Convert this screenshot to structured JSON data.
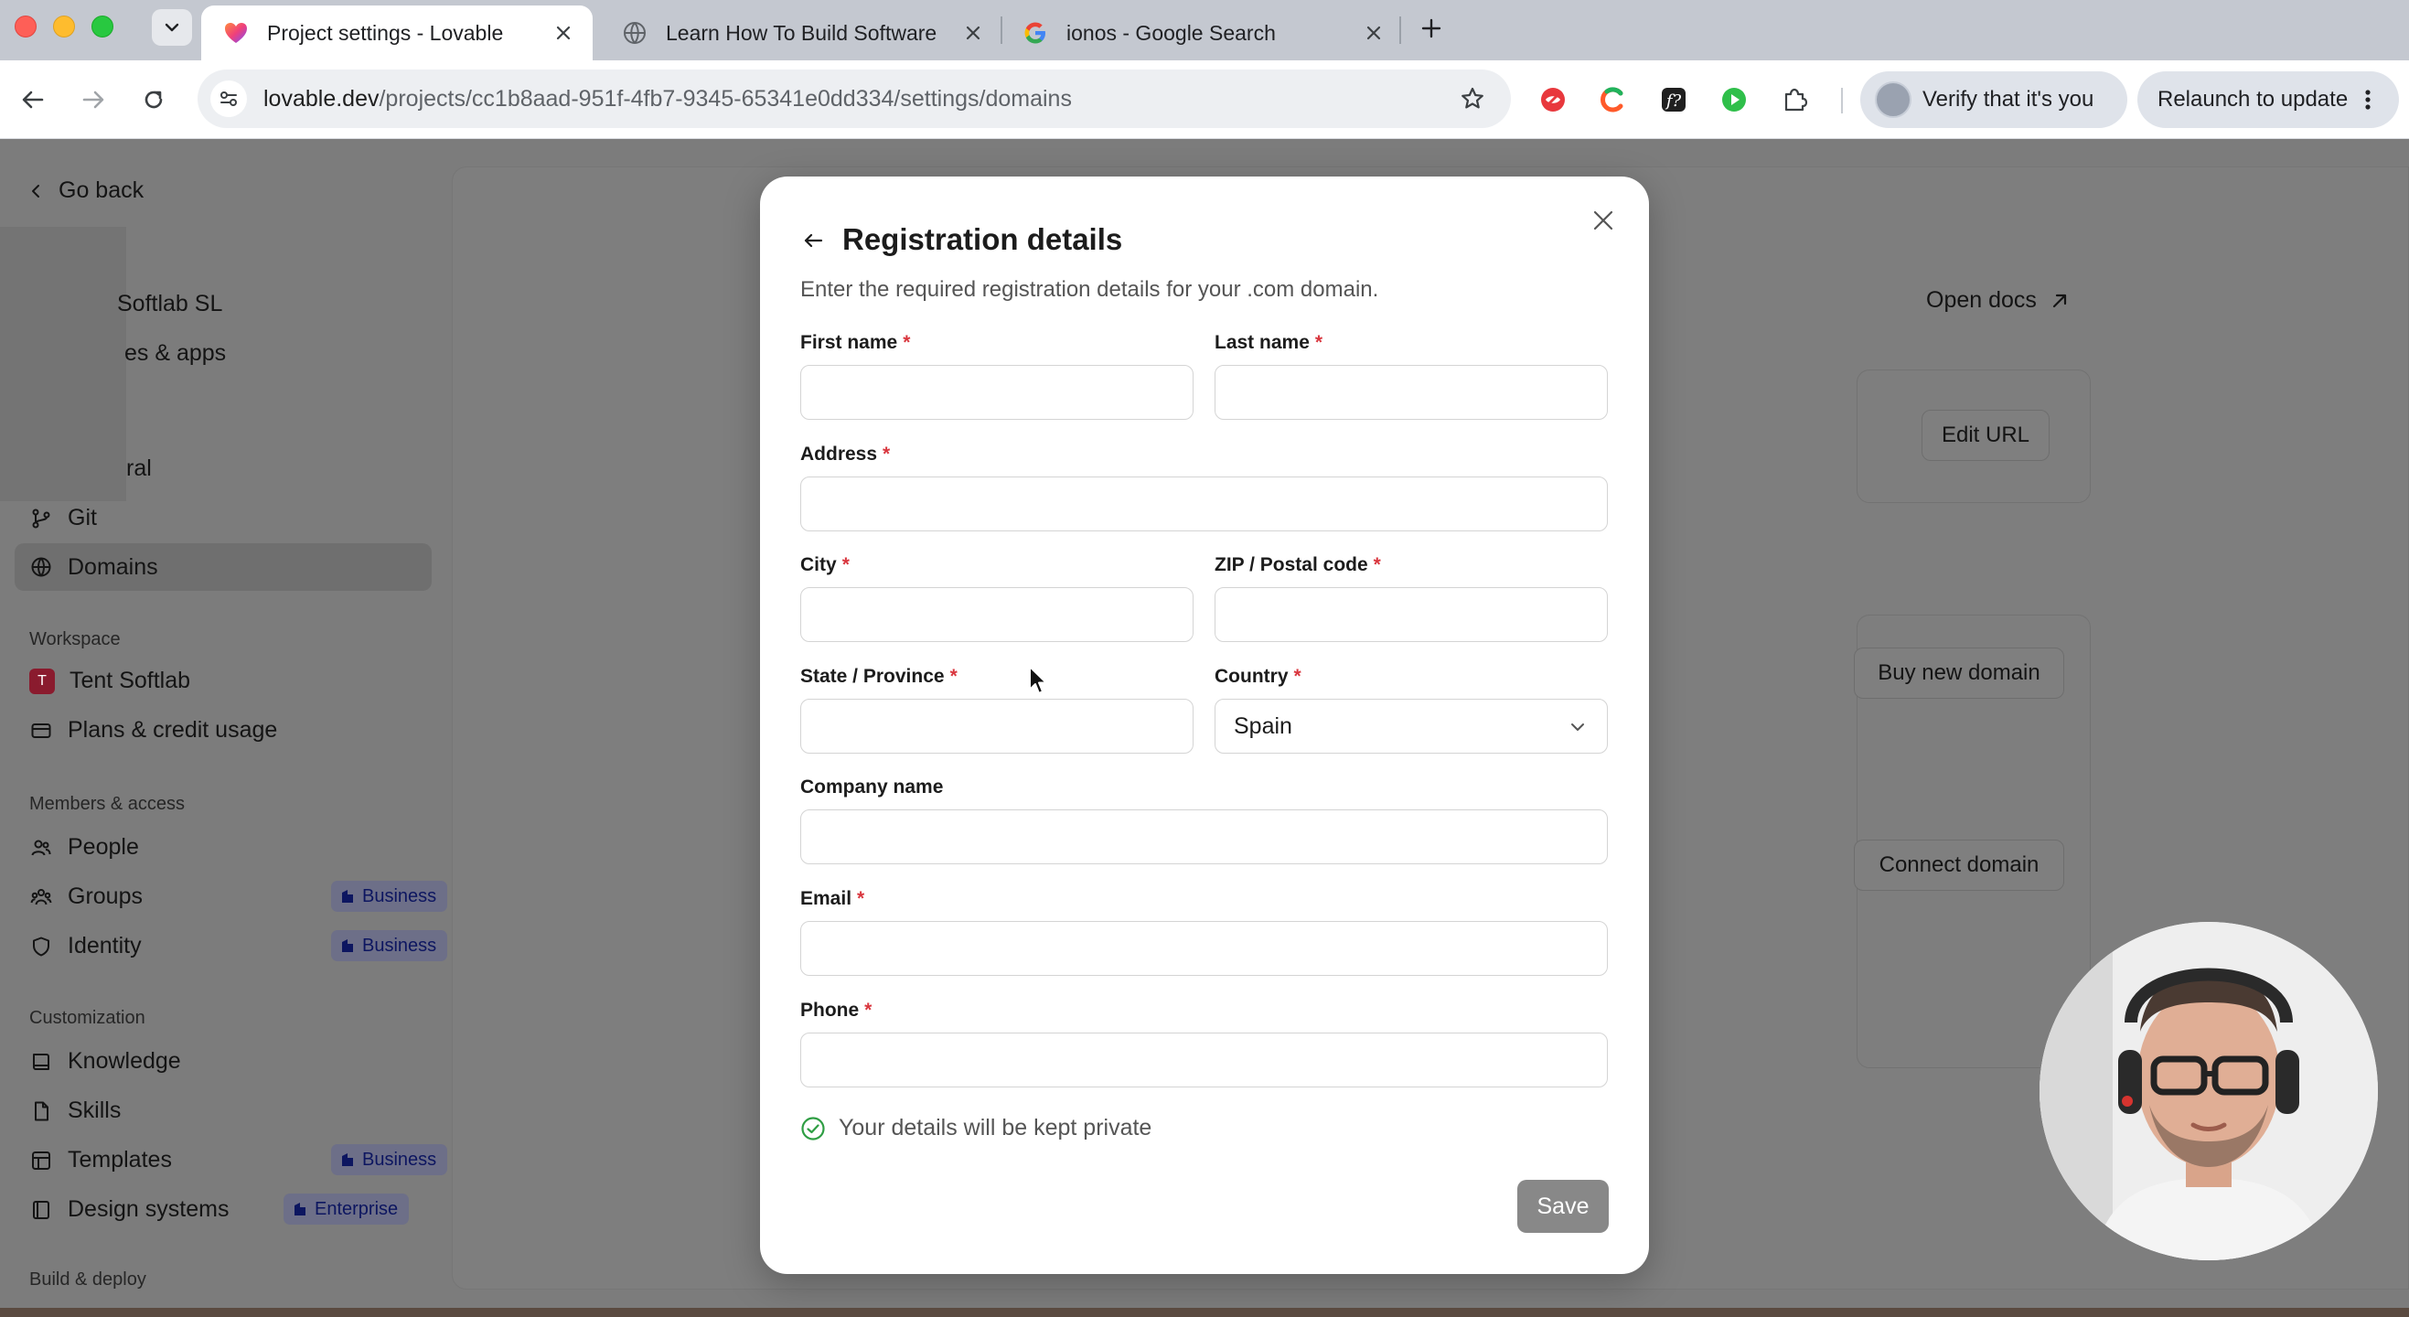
{
  "browser": {
    "tabs": [
      {
        "title": "Project settings - Lovable",
        "active": true
      },
      {
        "title": "Learn How To Build Software",
        "active": false
      },
      {
        "title": "ionos - Google Search",
        "active": false
      }
    ],
    "url_host": "lovable.dev",
    "url_path": "/projects/cc1b8aad-951f-4fb7-9345-65341e0dd334/settings/domains",
    "verify_label": "Verify that it's you",
    "relaunch_label": "Relaunch to update"
  },
  "sidebar": {
    "go_back": "Go back",
    "partial_items": [
      "Softlab SL",
      "es & apps",
      "ral"
    ],
    "git": "Git",
    "domains": "Domains",
    "workspace_heading": "Workspace",
    "workspace_initial": "T",
    "workspace_name": "Tent Softlab",
    "plans": "Plans & credit usage",
    "members_heading": "Members & access",
    "people": "People",
    "groups": "Groups",
    "identity": "Identity",
    "customization_heading": "Customization",
    "knowledge": "Knowledge",
    "skills": "Skills",
    "templates": "Templates",
    "design_systems": "Design systems",
    "build_heading": "Build & deploy",
    "badge_business": "Business",
    "badge_enterprise": "Enterprise"
  },
  "main": {
    "open_docs": "Open docs",
    "edit_url": "Edit URL",
    "buy_domain": "Buy new domain",
    "connect_domain": "Connect domain"
  },
  "modal": {
    "title": "Registration details",
    "subtitle": "Enter the required registration details for your .com domain.",
    "required_mark": "*",
    "labels": {
      "first_name": "First name",
      "last_name": "Last name",
      "address": "Address",
      "city": "City",
      "zip": "ZIP / Postal code",
      "state": "State / Province",
      "country": "Country",
      "company": "Company name",
      "email": "Email",
      "phone": "Phone"
    },
    "values": {
      "first_name": "",
      "last_name": "",
      "address": "",
      "city": "",
      "zip": "",
      "state": "",
      "country": "Spain",
      "company": "",
      "email": "",
      "phone": ""
    },
    "privacy": "Your details will be kept private",
    "save": "Save"
  },
  "colors": {
    "required": "#d9363e",
    "privacy_check": "#2f9e44",
    "save_disabled": "#888888"
  }
}
